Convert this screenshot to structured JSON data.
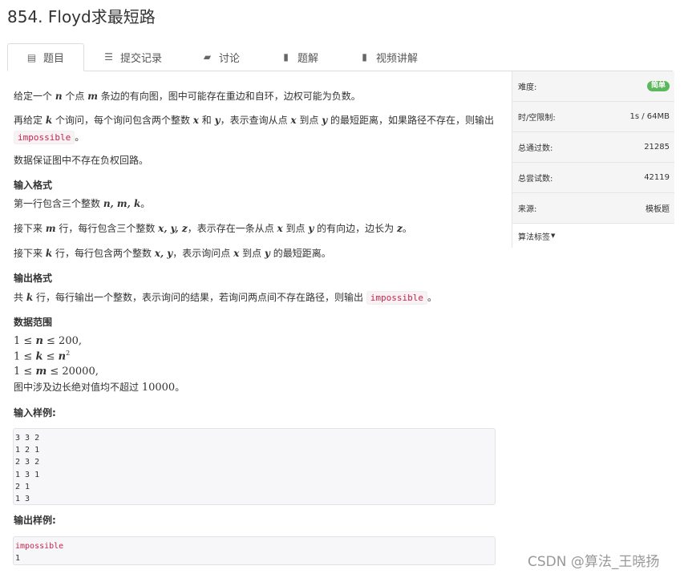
{
  "title": "854. Floyd求最短路",
  "tabs": [
    {
      "label": "题目",
      "icon": "list-icon"
    },
    {
      "label": "提交记录",
      "icon": "list-icon"
    },
    {
      "label": "讨论",
      "icon": "comment-icon"
    },
    {
      "label": "题解",
      "icon": "book-icon"
    },
    {
      "label": "视频讲解",
      "icon": "book-icon"
    }
  ],
  "problem": {
    "p1": {
      "a": "给定一个 ",
      "n": "n",
      "b": " 个点 ",
      "m": "m",
      "c": " 条边的有向图，图中可能存在重边和自环，边权可能为负数。"
    },
    "p2": {
      "a": "再给定 ",
      "k": "k",
      "b": " 个询问，每个询问包含两个整数 ",
      "x": "x",
      "c": " 和 ",
      "y": "y",
      "d": "，表示查询从点 ",
      "x2": "x",
      "e": " 到点 ",
      "y2": "y",
      "f": " 的最短距离，如果路径不存在，则输出",
      "code": "impossible",
      "g": "。"
    },
    "p3": "数据保证图中不存在负权回路。",
    "input_title": "输入格式",
    "in1": {
      "a": "第一行包含三个整数 ",
      "m": "n, m, k",
      "b": "。"
    },
    "in2": {
      "a": "接下来 ",
      "m": "m",
      "b": " 行，每行包含三个整数 ",
      "xyz": "x, y, z",
      "c": "，表示存在一条从点 ",
      "x": "x",
      "d": " 到点 ",
      "y": "y",
      "e": " 的有向边，边长为 ",
      "z": "z",
      "f": "。"
    },
    "in3": {
      "a": "接下来 ",
      "k": "k",
      "b": " 行，每行包含两个整数 ",
      "xy": "x, y",
      "c": "，表示询问点 ",
      "x": "x",
      "d": " 到点 ",
      "y": "y",
      "e": " 的最短距离。"
    },
    "output_title": "输出格式",
    "out1": {
      "a": "共 ",
      "k": "k",
      "b": " 行，每行输出一个整数，表示询问的结果，若询问两点间不存在路径，则输出 ",
      "code": "impossible",
      "c": "。"
    },
    "range_title": "数据范围",
    "r1": {
      "a": "1 ≤ ",
      "v": "n",
      "b": " ≤ 200,"
    },
    "r2": {
      "a": "1 ≤ ",
      "v": "k",
      "b": " ≤ ",
      "c": "n",
      "sup": "2"
    },
    "r3": {
      "a": "1 ≤ ",
      "v": "m",
      "b": " ≤ 20000,"
    },
    "r4": {
      "a": "图中涉及边长绝对值均不超过 ",
      "v": "10000",
      "b": "。"
    },
    "sample_in_title": "输入样例:",
    "sample_in": [
      "3 3 2",
      "1 2 1",
      "2 3 2",
      "1 3 1",
      "2 1",
      "1 3"
    ],
    "sample_out_title": "输出样例:",
    "sample_out": [
      "impossible",
      "1"
    ]
  },
  "side": {
    "difficulty_label": "难度:",
    "difficulty_value": "简单",
    "limit_label": "时/空限制:",
    "limit_value": "1s / 64MB",
    "passed_label": "总通过数:",
    "passed_value": "21285",
    "tried_label": "总尝试数:",
    "tried_value": "42119",
    "source_label": "来源:",
    "source_value": "模板题",
    "tags_label": "算法标签"
  },
  "watermark": "CSDN @算法_王晓扬",
  "colors": {
    "badge": "#5cb85c",
    "code": "#c7254e"
  }
}
